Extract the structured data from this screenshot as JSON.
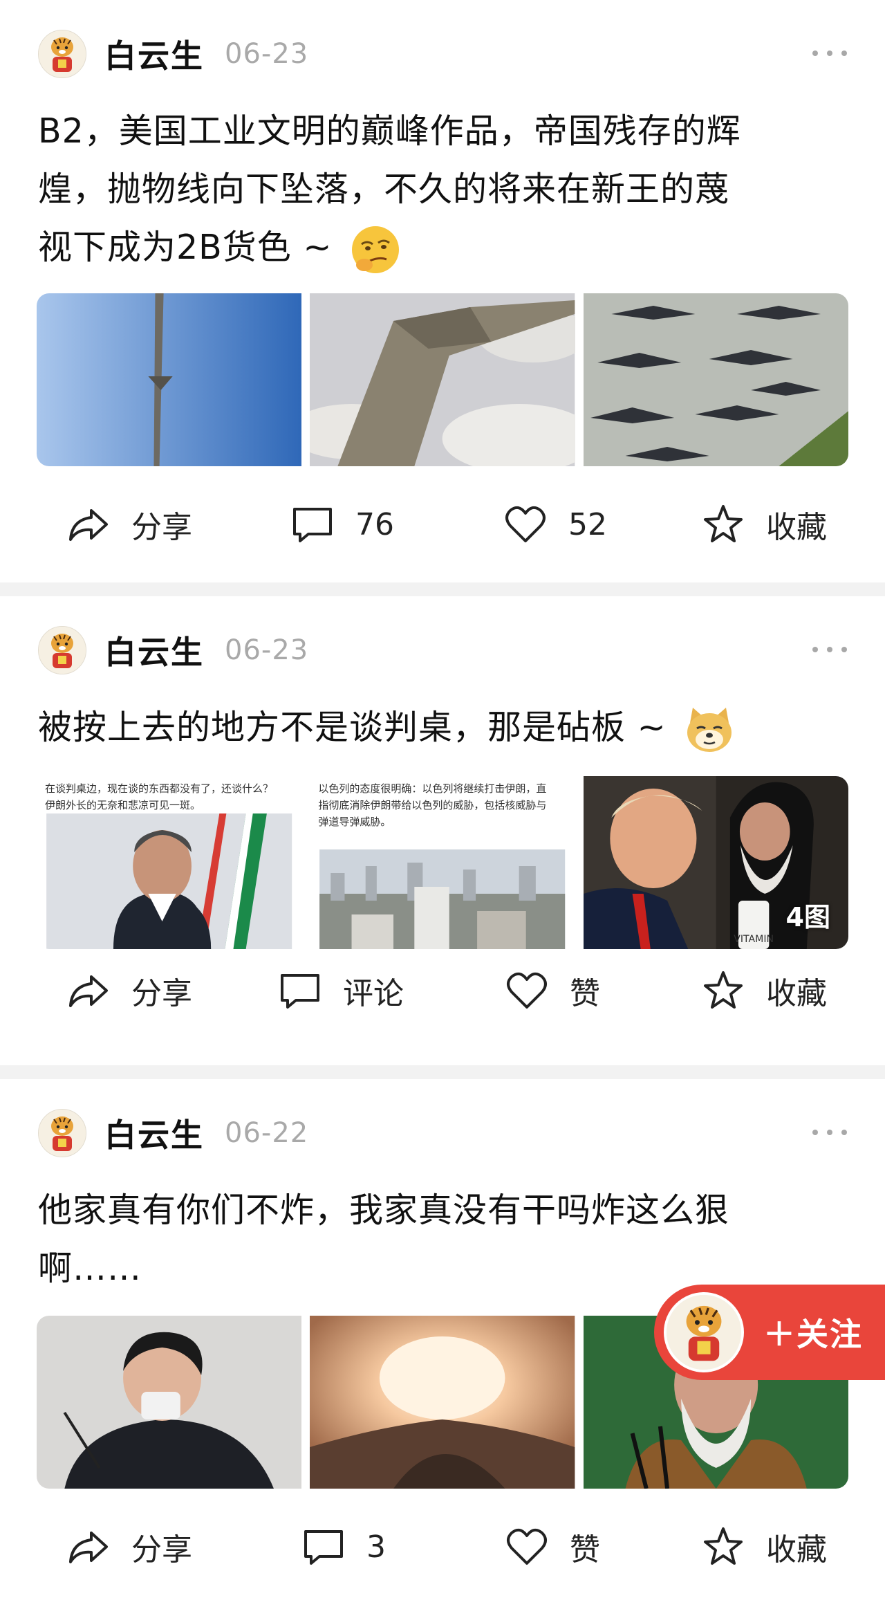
{
  "posts": [
    {
      "author": "白云生",
      "date": "06-23",
      "text_lines": [
        "B2，美国工业文明的巅峰作品，帝国残存的辉",
        "煌，抛物线向下坠落，不久的将来在新王的蔑",
        "视下成为2B货色 ~ "
      ],
      "emoji_icon": "smug-thinking-emoji",
      "images": [
        "b2-bomber-side-sky",
        "b2-bomber-over-clouds",
        "b2-bombers-on-airfield"
      ],
      "actions": {
        "share": "分享",
        "comment": "76",
        "like": "52",
        "favorite": "收藏"
      }
    },
    {
      "author": "白云生",
      "date": "06-23",
      "text_lines": [
        "被按上去的地方不是谈判桌，那是砧板 ~ "
      ],
      "emoji_icon": "doge-emoji",
      "image_captions": [
        "在谈判桌边，现在谈的东西都没有了，还谈什么？伊朗外长的无奈和悲凉可见一斑。",
        "以色列的态度很明确：以色列将继续打击伊朗，直指彻底消除伊朗带给以色列的威胁，包括核威胁与弹道导弹威胁。"
      ],
      "image_badge": "4图",
      "vitamin_label": "VITAMIN",
      "actions": {
        "share": "分享",
        "comment": "评论",
        "like": "赞",
        "favorite": "收藏"
      }
    },
    {
      "author": "白云生",
      "date": "06-22",
      "text_lines": [
        "他家真有你们不炸，我家真没有干吗炸这么狠",
        "啊……"
      ],
      "images": [
        "leader-wiping-tears",
        "explosion-fireball",
        "cleric-portrait"
      ],
      "actions": {
        "share": "分享",
        "comment": "3",
        "like": "赞",
        "favorite": "收藏"
      }
    }
  ],
  "follow_button": {
    "label": "＋关注"
  }
}
